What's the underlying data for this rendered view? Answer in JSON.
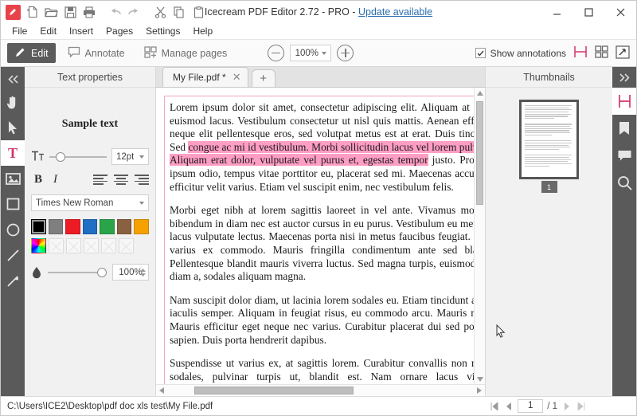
{
  "titlebar": {
    "title_main": "Icecream PDF Editor 2.72 - PRO - ",
    "title_link": "Update available",
    "minimize_label": "—",
    "maximize_label": "□",
    "close_label": "✕",
    "quick_icons": [
      {
        "name": "app-logo-icon",
        "label": "Icecream PDF Editor"
      },
      {
        "name": "new-file-icon",
        "label": "New"
      },
      {
        "name": "open-folder-icon",
        "label": "Open"
      },
      {
        "name": "save-icon",
        "label": "Save"
      },
      {
        "name": "print-icon",
        "label": "Print"
      },
      {
        "name": "undo-icon",
        "label": "Undo"
      },
      {
        "name": "redo-icon",
        "label": "Redo"
      },
      {
        "name": "cut-icon",
        "label": "Cut"
      },
      {
        "name": "copy-icon",
        "label": "Copy"
      },
      {
        "name": "paste-icon",
        "label": "Paste"
      }
    ]
  },
  "menubar": {
    "items": [
      {
        "label": "File"
      },
      {
        "label": "Edit"
      },
      {
        "label": "Insert"
      },
      {
        "label": "Pages"
      },
      {
        "label": "Settings"
      },
      {
        "label": "Help"
      }
    ]
  },
  "toolbar": {
    "modes": [
      {
        "label": "Edit",
        "icon": "pencil-icon",
        "active": true
      },
      {
        "label": "Annotate",
        "icon": "comment-icon",
        "active": false
      },
      {
        "label": "Manage pages",
        "icon": "pages-grid-icon",
        "active": false
      }
    ],
    "zoom_out_label": "−",
    "zoom_value": "100%",
    "zoom_in_label": "+",
    "show_annotations_label": "Show annotations",
    "show_annotations_checked": true,
    "check_glyph": "✔",
    "view_single_label": "single-page-view",
    "view_grid_label": "grid-view",
    "view_fullscreen_label": "fullscreen-view"
  },
  "left_rail": {
    "collapse_label": "«",
    "tools": [
      {
        "name": "hand-tool",
        "label": "Hand",
        "active": false
      },
      {
        "name": "select-tool",
        "label": "Select",
        "active": false
      },
      {
        "name": "text-tool",
        "label": "T",
        "active": true
      },
      {
        "name": "image-tool",
        "label": "Image",
        "active": false
      },
      {
        "name": "rectangle-tool",
        "label": "Rectangle",
        "active": false
      },
      {
        "name": "ellipse-tool",
        "label": "Ellipse",
        "active": false
      },
      {
        "name": "line-tool",
        "label": "Line",
        "active": false
      },
      {
        "name": "arrow-tool",
        "label": "Arrow",
        "active": false
      }
    ]
  },
  "text_properties": {
    "panel_title": "Text properties",
    "sample_text": "Sample text",
    "font_size": "12pt",
    "bold_label": "B",
    "italic_label": "I",
    "font_family": "Times New Roman",
    "align_options": [
      "align-left",
      "align-center",
      "align-right"
    ],
    "colors": [
      "#000000",
      "#7f7f7f",
      "#ed1c24",
      "#1f6fc4",
      "#2aa349",
      "#8a6140",
      "#f5a200"
    ],
    "selected_color": "#000000",
    "empty_slot_count": 5,
    "opacity": "100%",
    "dropdown_caret": "▾"
  },
  "tabs": {
    "open": [
      {
        "label": "My File.pdf *",
        "close_label": "✕",
        "active": true
      }
    ],
    "new_tab_label": "+"
  },
  "document": {
    "paragraphs": [
      {
        "segments": [
          {
            "text": "Lorem ipsum dolor sit amet, consectetur adipiscing elit. Aliquam at tellus euismod lacus. Vestibulum consectetur ut nisl quis mattis. Aenean efficitur neque elit pellentesque eros, sed volutpat metus est at erat. Duis tincidunt Sed ",
            "highlight": false
          },
          {
            "text": "congue ac mi id vestibulum. Morbi sollicitudin lacus vel lorem pulvinar. Aliquam erat dolor, vulputate vel purus et, egestas tempor",
            "highlight": true
          },
          {
            "text": " justo. Proin sit ipsum odio, tempus vitae porttitor eu, placerat sed mi. Maecenas accumsan efficitur velit varius. Etiam vel suscipit enim, nec vestibulum felis.",
            "highlight": false
          }
        ]
      },
      {
        "segments": [
          {
            "text": "Morbi eget nibh at lorem sagittis laoreet in vel ante. Vivamus molestie bibendum in diam nec est auctor cursus in eu purus. Vestibulum eu metus ut lacus vulputate lectus. Maecenas porta nisi in metus faucibus feugiat. Nunc varius ex commodo. Mauris fringilla condimentum ante sed blandit. Pellentesque blandit mauris viverra luctus. Sed magna turpis, euismod eget diam a, sodales aliquam magna.",
            "highlight": false
          }
        ]
      },
      {
        "segments": [
          {
            "text": "Nam suscipit dolor diam, ut lacinia lorem sodales eu. Etiam tincidunt augue iaculis semper. Aliquam in feugiat risus, eu commodo arcu. Mauris mattis Mauris efficitur eget neque nec varius. Curabitur placerat dui sed posuere sapien. Duis porta hendrerit dapibus.",
            "highlight": false
          }
        ]
      },
      {
        "segments": [
          {
            "text": "Suspendisse ut varius ex, at sagittis lorem. Curabitur convallis non neque sodales, pulvinar turpis ut, blandit est. Nam ornare lacus viverra pellentesque suscipit imperdiet sem in sagittis. Suspendisse sollicitudin quam mi. Nunc",
            "highlight": false
          }
        ]
      }
    ],
    "highlight_color": "#ff9ec4",
    "border_color": "#f2a7bd"
  },
  "thumbnails": {
    "panel_title": "Thumbnails",
    "pages": [
      {
        "number": "1",
        "selected": true
      }
    ]
  },
  "right_rail": {
    "expand_label": "»",
    "tools": [
      {
        "name": "pages-panel-icon",
        "label": "Pages",
        "active": true
      },
      {
        "name": "bookmark-icon",
        "label": "Bookmarks",
        "active": false
      },
      {
        "name": "comment-icon",
        "label": "Comments",
        "active": false
      },
      {
        "name": "search-icon",
        "label": "Search",
        "active": false
      }
    ]
  },
  "statusbar": {
    "file_path": "C:\\Users\\ICE2\\Desktop\\pdf doc xls test\\My File.pdf",
    "first_page_label": "⏮",
    "prev_page_label": "◀",
    "current_page": "1",
    "total_pages": "/ 1",
    "next_page_label": "▶",
    "last_page_label": "⏭"
  },
  "accent_colors": {
    "brand_red": "#e8424b",
    "rail_gray": "#5a5a5a",
    "link_blue": "#2b6cb0"
  }
}
